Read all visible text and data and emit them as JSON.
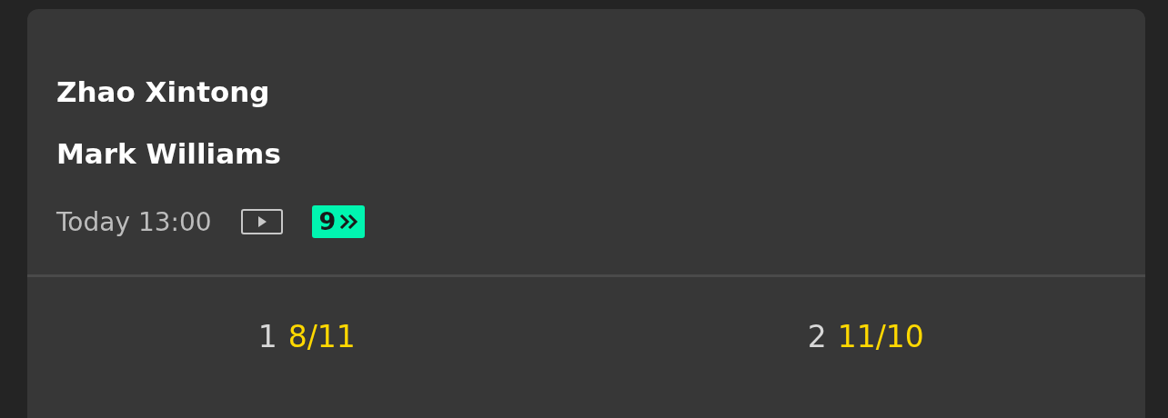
{
  "event": {
    "players": [
      "Zhao Xintong",
      "Mark Williams"
    ],
    "time": "Today 13:00",
    "badge": "9"
  },
  "odds": [
    {
      "label": "1",
      "price": "8/11"
    },
    {
      "label": "2",
      "price": "11/10"
    }
  ]
}
